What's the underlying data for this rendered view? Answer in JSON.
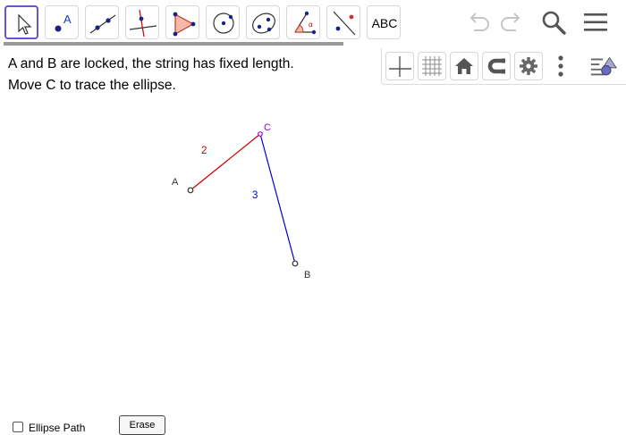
{
  "toolbar": {
    "tools": [
      {
        "name": "Move",
        "icon": "move-arrow-icon",
        "active": true
      },
      {
        "name": "Point",
        "icon": "point-icon",
        "label": "A"
      },
      {
        "name": "Line",
        "icon": "line-icon"
      },
      {
        "name": "Perpendicular Line",
        "icon": "perpendicular-line-icon"
      },
      {
        "name": "Polygon",
        "icon": "polygon-icon"
      },
      {
        "name": "Circle with Center",
        "icon": "circle-center-icon"
      },
      {
        "name": "Ellipse",
        "icon": "ellipse-icon"
      },
      {
        "name": "Angle",
        "icon": "angle-icon"
      },
      {
        "name": "Reflect about Line",
        "icon": "reflect-icon"
      },
      {
        "name": "Text",
        "icon": "text-icon",
        "label": "ABC"
      }
    ],
    "progress": 1.0,
    "actions": [
      "undo-icon",
      "redo-icon",
      "search-icon",
      "menu-icon"
    ]
  },
  "graphics_bar": {
    "buttons": [
      "axes-icon",
      "grid-icon",
      "home-icon",
      "magnet-icon",
      "settings-icon",
      "more-vertical-icon",
      "style-bar-toggle-icon"
    ]
  },
  "instructions": {
    "line1": "A and B are locked, the string has fixed length.",
    "line2": "Move C to trace the ellipse."
  },
  "construction": {
    "points": {
      "A": "A",
      "B": "B",
      "C": "C"
    },
    "segment_AC_length": "2",
    "segment_CB_length": "3",
    "colors": {
      "segment_AC": "#cc0000",
      "segment_CB": "#0000dd",
      "point_C": "#9900cc",
      "points_AB": "#333333"
    }
  },
  "bottom": {
    "checkbox_label": "Ellipse Path",
    "erase_label": "Erase"
  }
}
